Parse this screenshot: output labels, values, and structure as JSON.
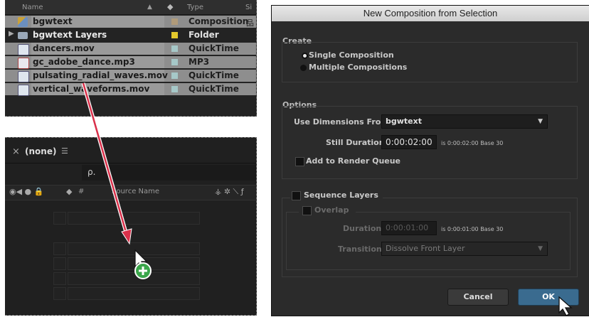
{
  "project_panel": {
    "headers": {
      "name": "Name",
      "type": "Type",
      "size": "Si"
    },
    "rows": [
      {
        "name": "bgwtext",
        "type": "Composition",
        "swatch": "#b09b7a",
        "icon": "composition-icon"
      },
      {
        "name": "bgwtext Layers",
        "type": "Folder",
        "swatch": "#e3c82c",
        "icon": "folder-icon"
      },
      {
        "name": "dancers.mov",
        "type": "QuickTime",
        "swatch": "#a6c8c8",
        "icon": "movie-file-icon"
      },
      {
        "name": "gc_adobe_dance.mp3",
        "type": "MP3",
        "swatch": "#a6c8c8",
        "icon": "audio-file-icon"
      },
      {
        "name": "pulsating_radial_waves.mov",
        "type": "QuickTime",
        "swatch": "#a6c8c8",
        "icon": "movie-file-icon"
      },
      {
        "name": "vertical_waveforms.mov",
        "type": "QuickTime",
        "swatch": "#a6c8c8",
        "icon": "movie-file-icon"
      }
    ]
  },
  "timeline_panel": {
    "close": "×",
    "title": "(none)",
    "menu": "☰",
    "search_icon": "ρ.",
    "column_source_name": "Source Name",
    "column_number": "#"
  },
  "dialog": {
    "title": "New Composition from Selection",
    "create": {
      "label": "Create",
      "options": [
        "Single Composition",
        "Multiple Compositions"
      ],
      "selected": "Single Composition"
    },
    "options": {
      "label": "Options",
      "use_dimensions_label": "Use Dimensions From:",
      "use_dimensions_value": "bgwtext",
      "still_duration_label": "Still Duration:",
      "still_duration_value": "0:00:02:00",
      "still_duration_note": "is 0:00:02:00  Base 30",
      "add_to_render_queue": "Add to Render Queue"
    },
    "sequence": {
      "label": "Sequence Layers",
      "overlap_label": "Overlap",
      "duration_label": "Duration:",
      "duration_value": "0:00:01:00",
      "duration_note": "is 0:00:01:00  Base 30",
      "transition_label": "Transition:",
      "transition_value": "Dissolve Front Layer"
    },
    "buttons": {
      "cancel": "Cancel",
      "ok": "OK"
    }
  },
  "colors": {
    "ok_button": "#3a6b8f",
    "add_badge": "#3aa64a",
    "arrow": "#d9304a"
  }
}
